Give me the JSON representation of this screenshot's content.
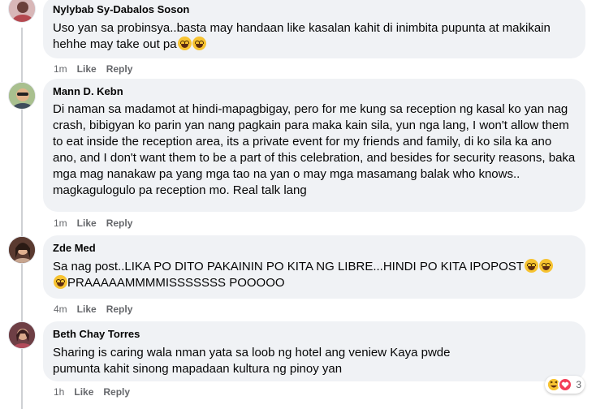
{
  "comments": [
    {
      "author": "Nylybab Sy-Dabalos Soson",
      "text": "Uso yan sa probinsya..basta may handaan like kasalan kahit di inimbita pupunta at makikain hehhe may take out pa",
      "time": "1m",
      "like": "Like",
      "reply": "Reply",
      "avatar_color": "#c9a2a8"
    },
    {
      "author": "Mann D. Kebn",
      "text": "Di naman sa madamot at hindi-mapagbigay, pero for me kung sa reception ng kasal ko yan nag crash, bibigyan ko parin yan nang pagkain para maka kain sila, yun nga lang, I won't allow them to eat inside the reception area, its a private event for my friends and family, di ko sila ka ano ano, and I don't want them to be a part of this celebration, and besides for security reasons, baka mga mag nanakaw pa yang mga tao na yan o may mga masamang balak who knows.. magkagulogulo pa reception mo. Real talk lang",
      "time": "1m",
      "like": "Like",
      "reply": "Reply",
      "avatar_color": "#9fb08a"
    },
    {
      "author": "Zde Med",
      "text": "Sa nag post..LIKA PO DITO PAKAININ PO KITA NG LIBRE...HINDI PO KITA IPOPOST",
      "text2": "PRAAAAAMMMMISSSSSSS POOOOO",
      "time": "4m",
      "like": "Like",
      "reply": "Reply",
      "avatar_color": "#7a4b3a"
    },
    {
      "author": "Beth Chay Torres",
      "text": "Sharing is caring wala nman yata sa loob ng hotel ang veniew Kaya pwde pumunta kahit sinong mapadaan kultura ng pinoy yan",
      "time": "1h",
      "like": "Like",
      "reply": "Reply",
      "avatar_color": "#8a5a5e",
      "reaction_count": "3"
    }
  ],
  "colors": {
    "bubble": "#f0f2f5",
    "meta": "#65676b",
    "text": "#050505"
  }
}
